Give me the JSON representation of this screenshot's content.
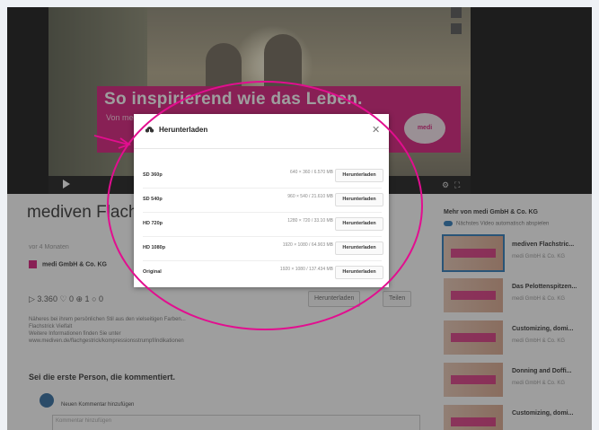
{
  "video": {
    "banner_title": "So inspirierend wie das Leben.",
    "banner_sub": "Von medi",
    "logo_text": "medi"
  },
  "page": {
    "title": "mediven Flach... wie das Leben",
    "date": "vor 4 Monaten",
    "channel": "medi GmbH & Co. KG",
    "stats": "▷ 3.360   ♡ 0   ⊕ 1   ○ 0",
    "add_to": "Herunterladen",
    "share": "Teilen",
    "description": [
      "Näheres bei ihrem persönlichen Stil aus den vielseitigen Farben...",
      "Flachstrick Vielfalt",
      "Weitere Informationen finden Sie unter",
      "www.mediven.de/flachgestrick/kompressionsstrumpf/indikationen"
    ],
    "comments_title": "Sei die erste Person, die kommentiert.",
    "add_comment": "Neuen Kommentar hinzufügen",
    "comment_placeholder": "Kommentar hinzufügen"
  },
  "sidebar": {
    "title": "Mehr von medi GmbH & Co. KG",
    "autoplay": "Nächstes Video automatisch abspielen",
    "items": [
      {
        "title": "mediven Flachstric...",
        "sub": "medi GmbH & Co. KG"
      },
      {
        "title": "Das Pelottenspitzen...",
        "sub": "medi GmbH & Co. KG"
      },
      {
        "title": "Customizing, domi...",
        "sub": "medi GmbH & Co. KG"
      },
      {
        "title": "Donning and Doffi...",
        "sub": "medi GmbH & Co. KG"
      },
      {
        "title": "Customizing, domi...",
        "sub": ""
      }
    ]
  },
  "modal": {
    "title": "Herunterladen",
    "close": "✕",
    "rows": [
      {
        "quality": "SD 360p",
        "size": "640 × 360 / 6.570 MB",
        "button": "Herunterladen"
      },
      {
        "quality": "SD 540p",
        "size": "960 × 540 / 21.610 MB",
        "button": "Herunterladen"
      },
      {
        "quality": "HD 720p",
        "size": "1280 × 720 / 33.10 MB",
        "button": "Herunterladen"
      },
      {
        "quality": "HD 1080p",
        "size": "1920 × 1080 / 64.903 MB",
        "button": "Herunterladen"
      },
      {
        "quality": "Original",
        "size": "1920 × 1080 / 137.434 MB",
        "button": "Herunterladen"
      }
    ]
  },
  "colors": {
    "accent": "#d81b7a",
    "annotation": "#e20e8f",
    "link": "#2b78b8"
  }
}
